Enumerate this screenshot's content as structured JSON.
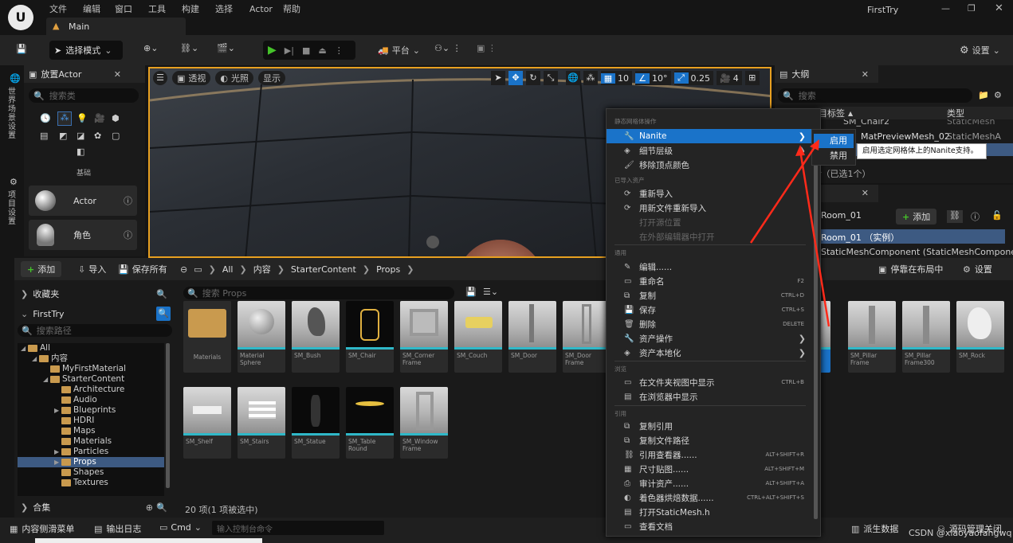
{
  "menubar": {
    "items": [
      "文件",
      "编辑",
      "窗口",
      "工具",
      "构建",
      "选择",
      "Actor",
      "帮助"
    ],
    "project": "FirstTry"
  },
  "level_tab": {
    "label": "Main"
  },
  "toolbar": {
    "mode": "选择模式",
    "platform": "平台",
    "settings": "设置"
  },
  "left_side_tabs": [
    "世界场景设置",
    "项目设置"
  ],
  "place_actor": {
    "title": "放置Actor",
    "search_placeholder": "搜索类",
    "category": "基础",
    "items": [
      {
        "label": "Actor"
      },
      {
        "label": "角色"
      }
    ]
  },
  "viewport": {
    "perspective": "透视",
    "lit": "光照",
    "show": "显示",
    "grid": "10",
    "rot": "10°",
    "scale": "0.25",
    "cam": "4"
  },
  "outliner": {
    "title": "大纲",
    "search_placeholder": "搜索",
    "col_label": "目标签",
    "col_type": "类型",
    "rows": [
      {
        "name": "SM_Chair2",
        "type": "StaticMesh"
      },
      {
        "name": "MatPreviewMesh_02",
        "type": "StaticMeshA"
      },
      {
        "name": "",
        "type": ""
      }
    ],
    "summary": "r（已选1个）"
  },
  "details": {
    "title": "Room_01",
    "add": "添加",
    "instance": "Room_01 （实例）",
    "component": "StaticMeshComponent (StaticMeshComponent)"
  },
  "content_browser": {
    "add": "添加",
    "import": "导入",
    "save_all": "保存所有",
    "path": [
      "All",
      "内容",
      "StarterContent",
      "Props"
    ],
    "dock": "停靠在布局中",
    "settings": "设置",
    "favorites": "收藏夹",
    "project": "FirstTry",
    "path_search": "搜索路径",
    "collections": "合集",
    "search_props": "搜索 Props",
    "count": "20 项(1 项被选中)",
    "tree": [
      {
        "label": "All",
        "indent": 0,
        "open": true
      },
      {
        "label": "内容",
        "indent": 1,
        "open": true
      },
      {
        "label": "MyFirstMaterial",
        "indent": 2
      },
      {
        "label": "StarterContent",
        "indent": 2,
        "open": true
      },
      {
        "label": "Architecture",
        "indent": 3
      },
      {
        "label": "Audio",
        "indent": 3
      },
      {
        "label": "Blueprints",
        "indent": 3,
        "caret": true
      },
      {
        "label": "HDRI",
        "indent": 3
      },
      {
        "label": "Maps",
        "indent": 3
      },
      {
        "label": "Materials",
        "indent": 3
      },
      {
        "label": "Particles",
        "indent": 3,
        "caret": true
      },
      {
        "label": "Props",
        "indent": 3,
        "caret": true,
        "selected": true
      },
      {
        "label": "Shapes",
        "indent": 3
      },
      {
        "label": "Textures",
        "indent": 3
      }
    ],
    "assets_row1": [
      "Materials",
      "Material Sphere",
      "SM_Bush",
      "SM_Chair",
      "SM_Corner Frame",
      "SM_Couch",
      "SM_Door",
      "SM_Door Frame"
    ],
    "assets_row1_right": [
      "",
      "SM_Pillar Frame",
      "SM_Pillar Frame300",
      "SM_Rock"
    ],
    "assets_row2": [
      "SM_Shelf",
      "SM_Stairs",
      "SM_Statue",
      "SM_Table Round",
      "SM_Window Frame"
    ]
  },
  "context_menu": {
    "section1": "静态网格体操作",
    "nanite": "Nanite",
    "lod": "细节层级",
    "remove_vc": "移除顶点颜色",
    "section2": "已导入资产",
    "reimport": "重新导入",
    "reimport_new": "用新文件重新导入",
    "open_source": "打开源位置",
    "open_external": "在外部编辑器中打开",
    "section3": "通用",
    "edit": "编辑......",
    "rename": "重命名",
    "rename_sc": "F2",
    "duplicate": "复制",
    "duplicate_sc": "CTRL+D",
    "save": "保存",
    "save_sc": "CTRL+S",
    "delete": "删除",
    "delete_sc": "DELETE",
    "asset_actions": "资产操作",
    "localize": "资产本地化",
    "section4": "浏览",
    "show_folder": "在文件夹视图中显示",
    "show_folder_sc": "CTRL+B",
    "show_explorer": "在浏览器中显示",
    "section5": "引用",
    "copy_ref": "复制引用",
    "copy_path": "复制文件路径",
    "ref_viewer": "引用查看器......",
    "ref_viewer_sc": "ALT+SHIFT+R",
    "size_map": "尺寸贴图......",
    "size_map_sc": "ALT+SHIFT+M",
    "audit": "审计资产......",
    "audit_sc": "ALT+SHIFT+A",
    "shader_bake": "着色器烘焙数据......",
    "shader_bake_sc": "CTRL+ALT+SHIFT+S",
    "open_mesh_h": "打开StaticMesh.h",
    "view_docs": "查看文档"
  },
  "submenu": {
    "enable": "启用",
    "disable": "禁用",
    "tooltip": "启用选定网格体上的Nanite支持。"
  },
  "statusbar": {
    "drawer": "内容侧滑菜单",
    "output": "输出日志",
    "cmd": "Cmd",
    "console_placeholder": "输入控制台命令",
    "derived": "派生数据",
    "source_control": "源码管理关闭",
    "watermark": "CSDN @xiaoyaofangwq"
  },
  "colors": {
    "accent": "#1a73c9",
    "selected_row": "#3d5a82",
    "cyan": "#2fb8c8",
    "play": "#45c32a",
    "annotation": "#ff2a1a"
  }
}
